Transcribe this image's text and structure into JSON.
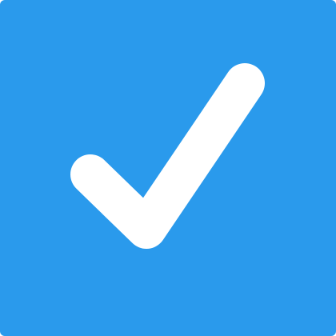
{
  "checkbox": {
    "checked": true,
    "icon": "checkmark-icon",
    "colors": {
      "background": "#2a9aec",
      "checkmark": "#ffffff"
    }
  }
}
